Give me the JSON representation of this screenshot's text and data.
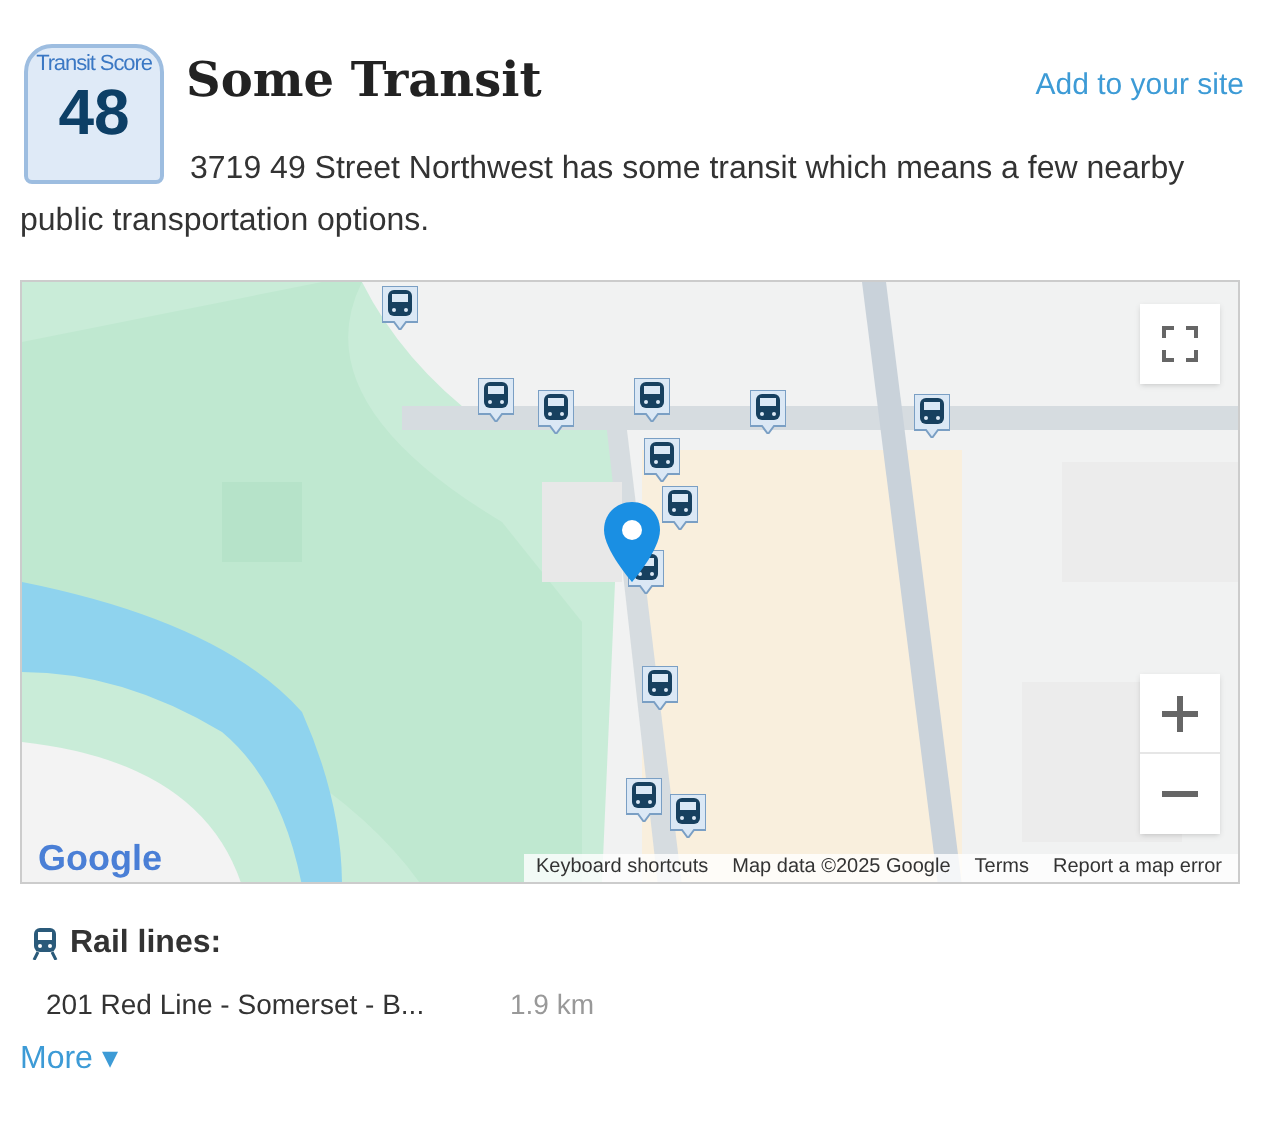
{
  "badge": {
    "label": "Transit Score",
    "score": "48"
  },
  "title": "Some Transit",
  "add_link": "Add to your site",
  "description": "3719 49 Street Northwest has some transit which means a few nearby public transportation options.",
  "map": {
    "logo": "Google",
    "attribution": [
      "Keyboard shortcuts",
      "Map data ©2025 Google",
      "Terms",
      "Report a map error"
    ]
  },
  "rail": {
    "heading": "Rail lines:",
    "lines": [
      {
        "name": "201 Red Line - Somerset - B...",
        "distance": "1.9 km"
      }
    ]
  },
  "more": {
    "label": "More",
    "arrow": "▾"
  }
}
